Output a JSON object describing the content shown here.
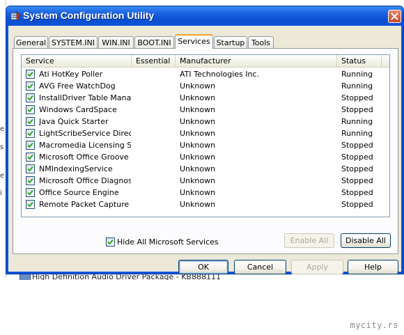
{
  "window": {
    "title": "System Configuration Utility"
  },
  "tabs": [
    {
      "label": "General"
    },
    {
      "label": "SYSTEM.INI"
    },
    {
      "label": "WIN.INI"
    },
    {
      "label": "BOOT.INI"
    },
    {
      "label": "Services",
      "active": true
    },
    {
      "label": "Startup"
    },
    {
      "label": "Tools"
    }
  ],
  "services": {
    "columns": [
      "Service",
      "Essential",
      "Manufacturer",
      "Status"
    ],
    "rows": [
      {
        "checked": true,
        "service": "Ati HotKey Poller",
        "essential": "",
        "manufacturer": "ATI Technologies Inc.",
        "status": "Running"
      },
      {
        "checked": true,
        "service": "AVG Free WatchDog",
        "essential": "",
        "manufacturer": "Unknown",
        "status": "Running"
      },
      {
        "checked": true,
        "service": "InstallDriver Table Mana...",
        "essential": "",
        "manufacturer": "Unknown",
        "status": "Stopped"
      },
      {
        "checked": true,
        "service": "Windows CardSpace",
        "essential": "",
        "manufacturer": "Unknown",
        "status": "Stopped"
      },
      {
        "checked": true,
        "service": "Java Quick Starter",
        "essential": "",
        "manufacturer": "Unknown",
        "status": "Running"
      },
      {
        "checked": true,
        "service": "LightScribeService Direct...",
        "essential": "",
        "manufacturer": "Unknown",
        "status": "Running"
      },
      {
        "checked": true,
        "service": "Macromedia Licensing Se...",
        "essential": "",
        "manufacturer": "Unknown",
        "status": "Stopped"
      },
      {
        "checked": true,
        "service": "Microsoft Office Groove ...",
        "essential": "",
        "manufacturer": "Unknown",
        "status": "Stopped"
      },
      {
        "checked": true,
        "service": "NMIndexingService",
        "essential": "",
        "manufacturer": "Unknown",
        "status": "Stopped"
      },
      {
        "checked": true,
        "service": "Microsoft Office Diagnos...",
        "essential": "",
        "manufacturer": "Unknown",
        "status": "Stopped"
      },
      {
        "checked": true,
        "service": "Office Source Engine",
        "essential": "",
        "manufacturer": "Unknown",
        "status": "Stopped"
      },
      {
        "checked": true,
        "service": "Remote Packet Capture ...",
        "essential": "",
        "manufacturer": "Unknown",
        "status": "Stopped"
      }
    ],
    "hide_ms_label": "Hide All Microsoft Services",
    "hide_ms_checked": true,
    "enable_all_label": "Enable All",
    "disable_all_label": "Disable All"
  },
  "buttons": {
    "ok": "OK",
    "cancel": "Cancel",
    "apply": "Apply",
    "help": "Help"
  },
  "background": {
    "left_fragments": [
      "e",
      "s",
      "e",
      "i"
    ],
    "taskbar_text": "High Definition Audio Driver Package - KB888111",
    "watermark": "mycity.rs"
  }
}
